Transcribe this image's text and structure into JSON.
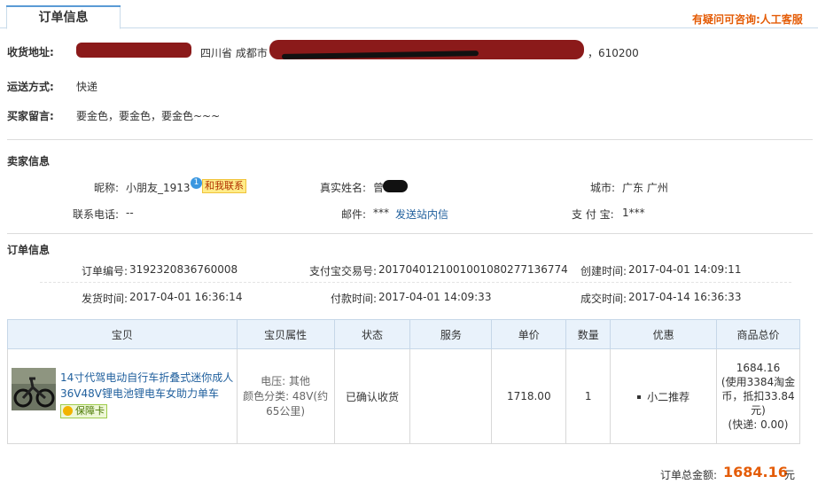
{
  "tab": {
    "title": "订单信息"
  },
  "help_link": "有疑问可咨询:人工客服",
  "shipping": {
    "address_label": "收货地址:",
    "address_visible": "四川省 成都市",
    "address_zip": "，610200",
    "delivery_label": "运送方式:",
    "delivery_value": "快递",
    "message_label": "买家留言:",
    "message_value": "要金色，要金色，要金色~~~"
  },
  "seller": {
    "heading": "卖家信息",
    "nick_label": "昵称:",
    "nick_value": "小朋友_1913",
    "contact_badge": "和我联系",
    "name_label": "真实姓名:",
    "name_value": "曾",
    "city_label": "城市:",
    "city_value": "广东 广州",
    "phone_label": "联系电话:",
    "phone_value": "--",
    "email_label": "邮件:",
    "email_value": "***",
    "email_link": "发送站内信",
    "alipay_label": "支 付 宝:",
    "alipay_value": "1***"
  },
  "order": {
    "heading": "订单信息",
    "order_no_label": "订单编号:",
    "order_no": "3192320836760008",
    "alipay_trade_label": "支付宝交易号:",
    "alipay_trade_no": "2017040121001001080277136774",
    "created_label": "创建时间:",
    "created": "2017-04-01 14:09:11",
    "shipped_label": "发货时间:",
    "shipped": "2017-04-01 16:36:14",
    "paid_label": "付款时间:",
    "paid": "2017-04-01 14:09:33",
    "done_label": "成交时间:",
    "done": "2017-04-14 16:36:33"
  },
  "table": {
    "headers": [
      "宝贝",
      "宝贝属性",
      "状态",
      "服务",
      "单价",
      "数量",
      "优惠",
      "商品总价"
    ],
    "row": {
      "title_line1": "14寸代驾电动自行车折叠式迷你成人",
      "title_line2": "36V48V锂电池锂电车女助力单车",
      "guarantee": "保障卡",
      "attr_line1": "电压: 其他",
      "attr_line2": "颜色分类: 48V(约",
      "attr_line3": "65公里)",
      "status": "已确认收货",
      "service": "",
      "unit_price": "1718.00",
      "quantity": "1",
      "discount": "小二推荐",
      "total_line1": "1684.16",
      "total_line2": "(使用3384淘金",
      "total_line3": "币，抵扣33.84",
      "total_line4": "元)",
      "total_line5": "(快递: 0.00)"
    }
  },
  "summary": {
    "label": "订单总金额:",
    "amount": "1684.16",
    "unit": "元"
  }
}
